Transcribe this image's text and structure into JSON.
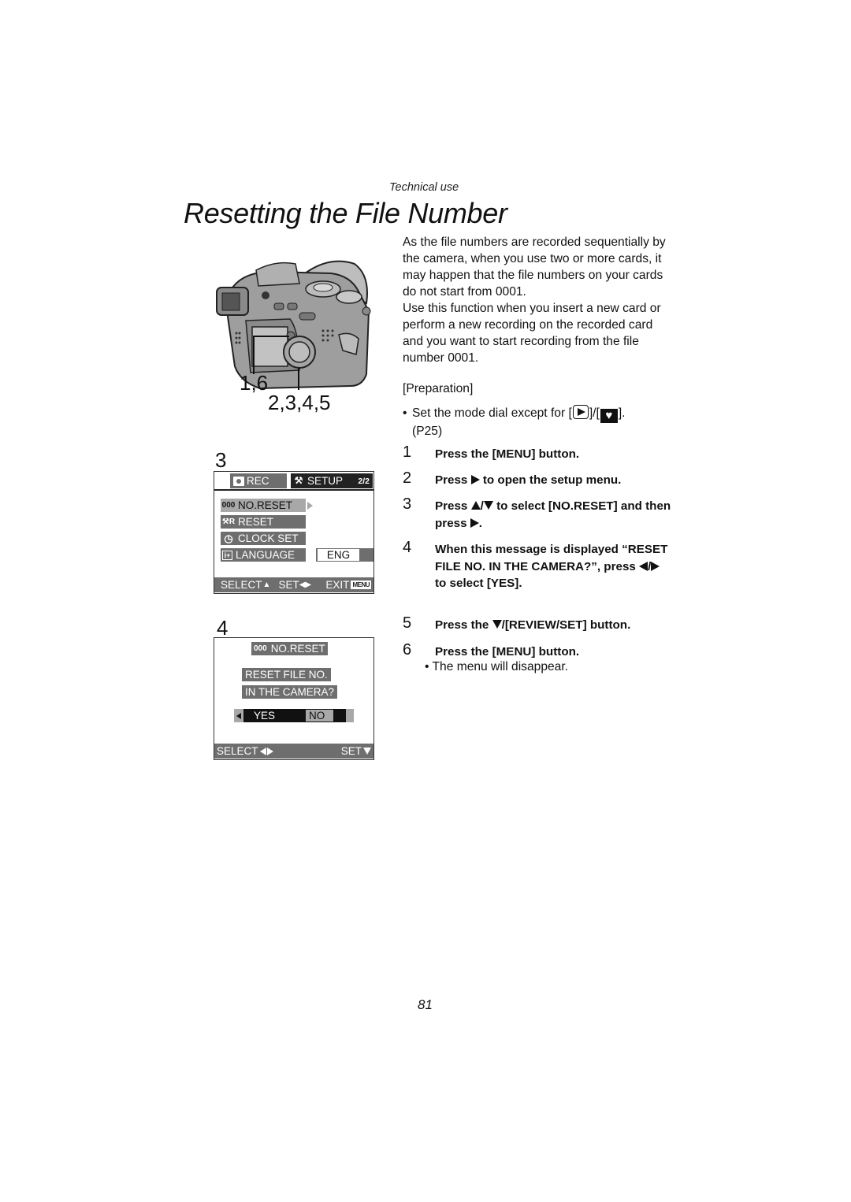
{
  "header": {
    "section_label": "Technical use",
    "title": "Resetting the File Number"
  },
  "figure": {
    "camera_labels": [
      "1,6",
      "2,3,4,5"
    ],
    "screen_step_3": {
      "step_number": "3",
      "tabs": [
        {
          "icon": "camera-icon",
          "label": "REC"
        },
        {
          "icon": "wrench-icon",
          "label": "SETUP",
          "page": "2/2"
        }
      ],
      "items": [
        {
          "icon": "file-number-icon",
          "label": "NO.RESET",
          "selected": true
        },
        {
          "icon": "reset-icon",
          "label": "RESET",
          "selected": false
        },
        {
          "icon": "clock-icon",
          "label": "CLOCK SET",
          "selected": false
        },
        {
          "icon": "language-icon",
          "label": "LANGUAGE",
          "selected": false,
          "value": "ENG"
        }
      ],
      "footer": {
        "select": "SELECT",
        "set": "SET",
        "exit": "EXIT",
        "menu_badge": "MENU"
      }
    },
    "screen_step_4": {
      "step_number": "4",
      "title": "NO.RESET",
      "message_lines": [
        "RESET FILE NO.",
        "IN THE CAMERA?"
      ],
      "options": {
        "yes": "YES",
        "no": "NO",
        "selected": "YES"
      },
      "footer": {
        "select": "SELECT",
        "set": "SET"
      }
    }
  },
  "body": {
    "intro": "As the file numbers are recorded sequentially by the camera, when you use two or more cards, it may happen that the file numbers on your cards do not start from 0001.",
    "intro_2": "Use this function when you insert a new card or perform a new recording on the recorded card and you want to start recording from the file number 0001.",
    "preparation_title": "[Preparation]",
    "preparation_bullet_pre": "Set the mode dial except for [",
    "preparation_bullet_mid": "]/[",
    "preparation_bullet_post": "].",
    "preparation_ref": "(P25)",
    "steps": [
      {
        "n": "1",
        "text": "Press the [MENU] button."
      },
      {
        "n": "2",
        "pre": "Press",
        "post": "to open the setup menu."
      },
      {
        "n": "3",
        "pre": "Press",
        "mid": "/",
        "post": "to select [NO.RESET] and then press",
        "end": "."
      },
      {
        "n": "4",
        "pre": "When this message is displayed “RESET FILE NO. IN THE CAMERA?”, press",
        "mid": "/",
        "post": "to select [YES]."
      },
      {
        "n": "5",
        "pre": "Press the",
        "post": "/[REVIEW/SET] button."
      },
      {
        "n": "6",
        "text": "Press the [MENU] button."
      }
    ],
    "step6_note": "The menu will disappear."
  },
  "footer": {
    "page_number": "81"
  }
}
